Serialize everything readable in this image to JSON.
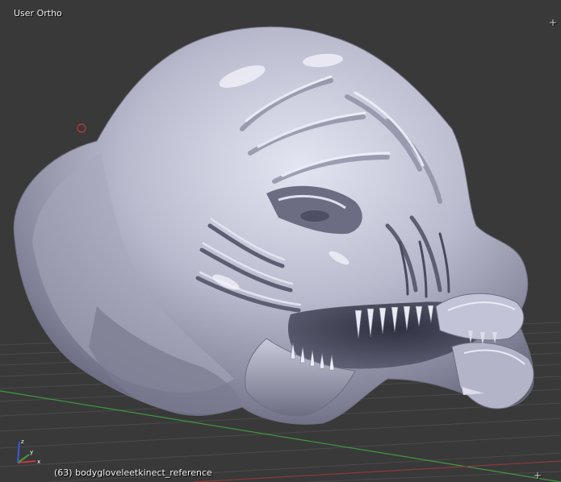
{
  "viewport": {
    "view_name": "User Ortho",
    "object_frame": "(63)",
    "object_name": "bodygloveleetkinect_reference",
    "background_color": "#393939",
    "grid_color": "#4a4a4a",
    "x_axis_color": "#a23b3b",
    "y_axis_color": "#3f9a3f",
    "z_axis_color": "#3d5ad8",
    "cursor_color": "#c63a3a",
    "mesh_color": "#b7b8cc",
    "mesh_description": "Sculpted creature head mesh"
  },
  "gizmo": {
    "x_label": "x",
    "y_label": "y",
    "z_label": "z"
  },
  "icons": {
    "region_split_top_right": "plus-icon",
    "region_split_bottom_right": "plus-icon",
    "3d_cursor": "3d-cursor-icon"
  }
}
